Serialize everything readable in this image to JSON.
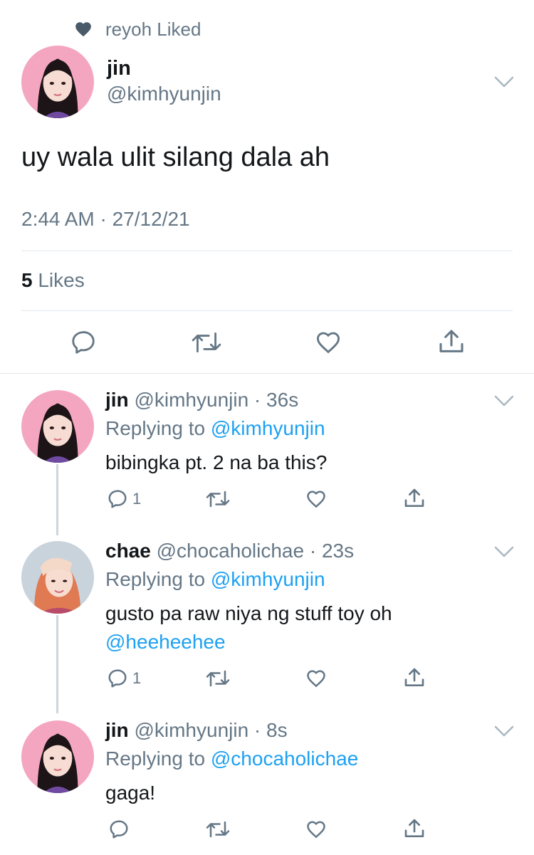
{
  "social_context": {
    "text": "reyoh Liked"
  },
  "main_tweet": {
    "name": "jin",
    "handle": "@kimhyunjin",
    "text": "uy wala ulit silang dala ah",
    "timestamp": "2:44 AM · 27/12/21",
    "likes_count": "5",
    "likes_label": " Likes"
  },
  "replies": [
    {
      "name": "jin",
      "handle": "@kimhyunjin",
      "time": "36s",
      "replying_prefix": "Replying to ",
      "replying_to": "@kimhyunjin",
      "text": "bibingka pt. 2 na ba this?",
      "text_mention": "",
      "reply_count": "1"
    },
    {
      "name": "chae",
      "handle": "@chocaholichae",
      "time": "23s",
      "replying_prefix": "Replying to ",
      "replying_to": "@kimhyunjin",
      "text": "gusto pa raw niya ng stuff toy oh",
      "text_mention": "@heeheehee",
      "reply_count": "1"
    },
    {
      "name": "jin",
      "handle": "@kimhyunjin",
      "time": "8s",
      "replying_prefix": "Replying to ",
      "replying_to": "@chocaholichae",
      "text": "gaga!",
      "text_mention": "",
      "reply_count": ""
    }
  ],
  "icons": {
    "heart_filled": "heart-icon",
    "chevron": "chevron-down-icon",
    "reply": "reply-icon",
    "retweet": "retweet-icon",
    "like": "like-icon",
    "share": "share-icon"
  },
  "colors": {
    "link": "#1da1f2",
    "secondary_text": "#657786",
    "icon": "#657786",
    "divider": "#e1e8ed",
    "avatar_bg_pink": "#f4a6c0"
  }
}
